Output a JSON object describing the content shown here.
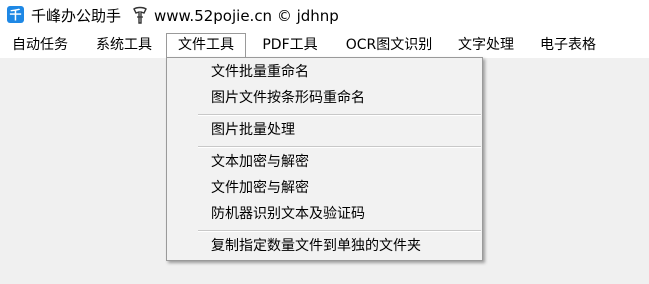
{
  "window": {
    "title": "千峰办公助手",
    "app_icon_glyph": "千",
    "link_icon": "link-icon",
    "link_text": "www.52pojie.cn © jdhnp"
  },
  "menubar": {
    "items": [
      {
        "label": "自动任务"
      },
      {
        "label": "系统工具"
      },
      {
        "label": "文件工具"
      },
      {
        "label": "PDF工具"
      },
      {
        "label": "OCR图文识别"
      },
      {
        "label": "文字处理"
      },
      {
        "label": "电子表格"
      }
    ],
    "open_index": 2
  },
  "dropdown": {
    "items": [
      {
        "label": "文件批量重命名"
      },
      {
        "label": "图片文件按条形码重命名"
      },
      {
        "label": "图片批量处理"
      },
      {
        "label": "文本加密与解密"
      },
      {
        "label": "文件加密与解密"
      },
      {
        "label": "防机器识别文本及验证码"
      },
      {
        "label": "复制指定数量文件到单独的文件夹"
      }
    ]
  },
  "colors": {
    "app_icon": "#1e88e5",
    "background": "#f0f0f0",
    "menu_background": "#ffffff"
  }
}
